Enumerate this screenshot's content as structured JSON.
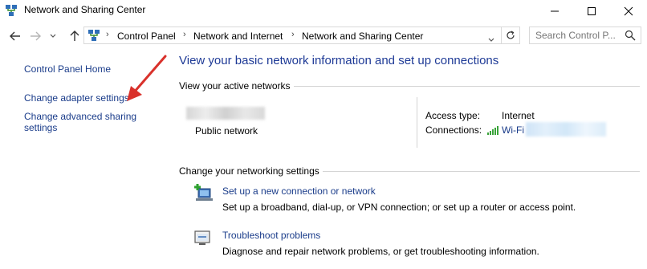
{
  "window": {
    "title": "Network and Sharing Center",
    "controls": [
      "minimize",
      "maximize",
      "close"
    ]
  },
  "navigation": {
    "back": "back-arrow-icon",
    "forward": "forward-arrow-icon",
    "recent": "chevron-down-icon",
    "up": "up-arrow-icon"
  },
  "breadcrumb": {
    "items": [
      "Control Panel",
      "Network and Internet",
      "Network and Sharing Center"
    ]
  },
  "search": {
    "placeholder": "Search Control P..."
  },
  "left_pane": {
    "home": "Control Panel Home",
    "adapter": "Change adapter settings",
    "advanced_line1": "Change advanced sharing",
    "advanced_line2": "settings"
  },
  "main": {
    "heading": "View your basic network information and set up connections",
    "active_networks_label": "View your active networks",
    "network_type": "Public network",
    "access_type_label": "Access type:",
    "access_type_value": "Internet",
    "connections_label": "Connections:",
    "connection_name": "Wi-Fi",
    "change_settings_label": "Change your networking settings",
    "tasks": [
      {
        "title": "Set up a new connection or network",
        "desc": "Set up a broadband, dial-up, or VPN connection; or set up a router or access point."
      },
      {
        "title": "Troubleshoot problems",
        "desc": "Diagnose and repair network problems, or get troubleshooting information."
      }
    ]
  },
  "colors": {
    "link": "#1a3c8a",
    "heading": "#1e3a96",
    "arrow_annotation": "#d9312b"
  }
}
